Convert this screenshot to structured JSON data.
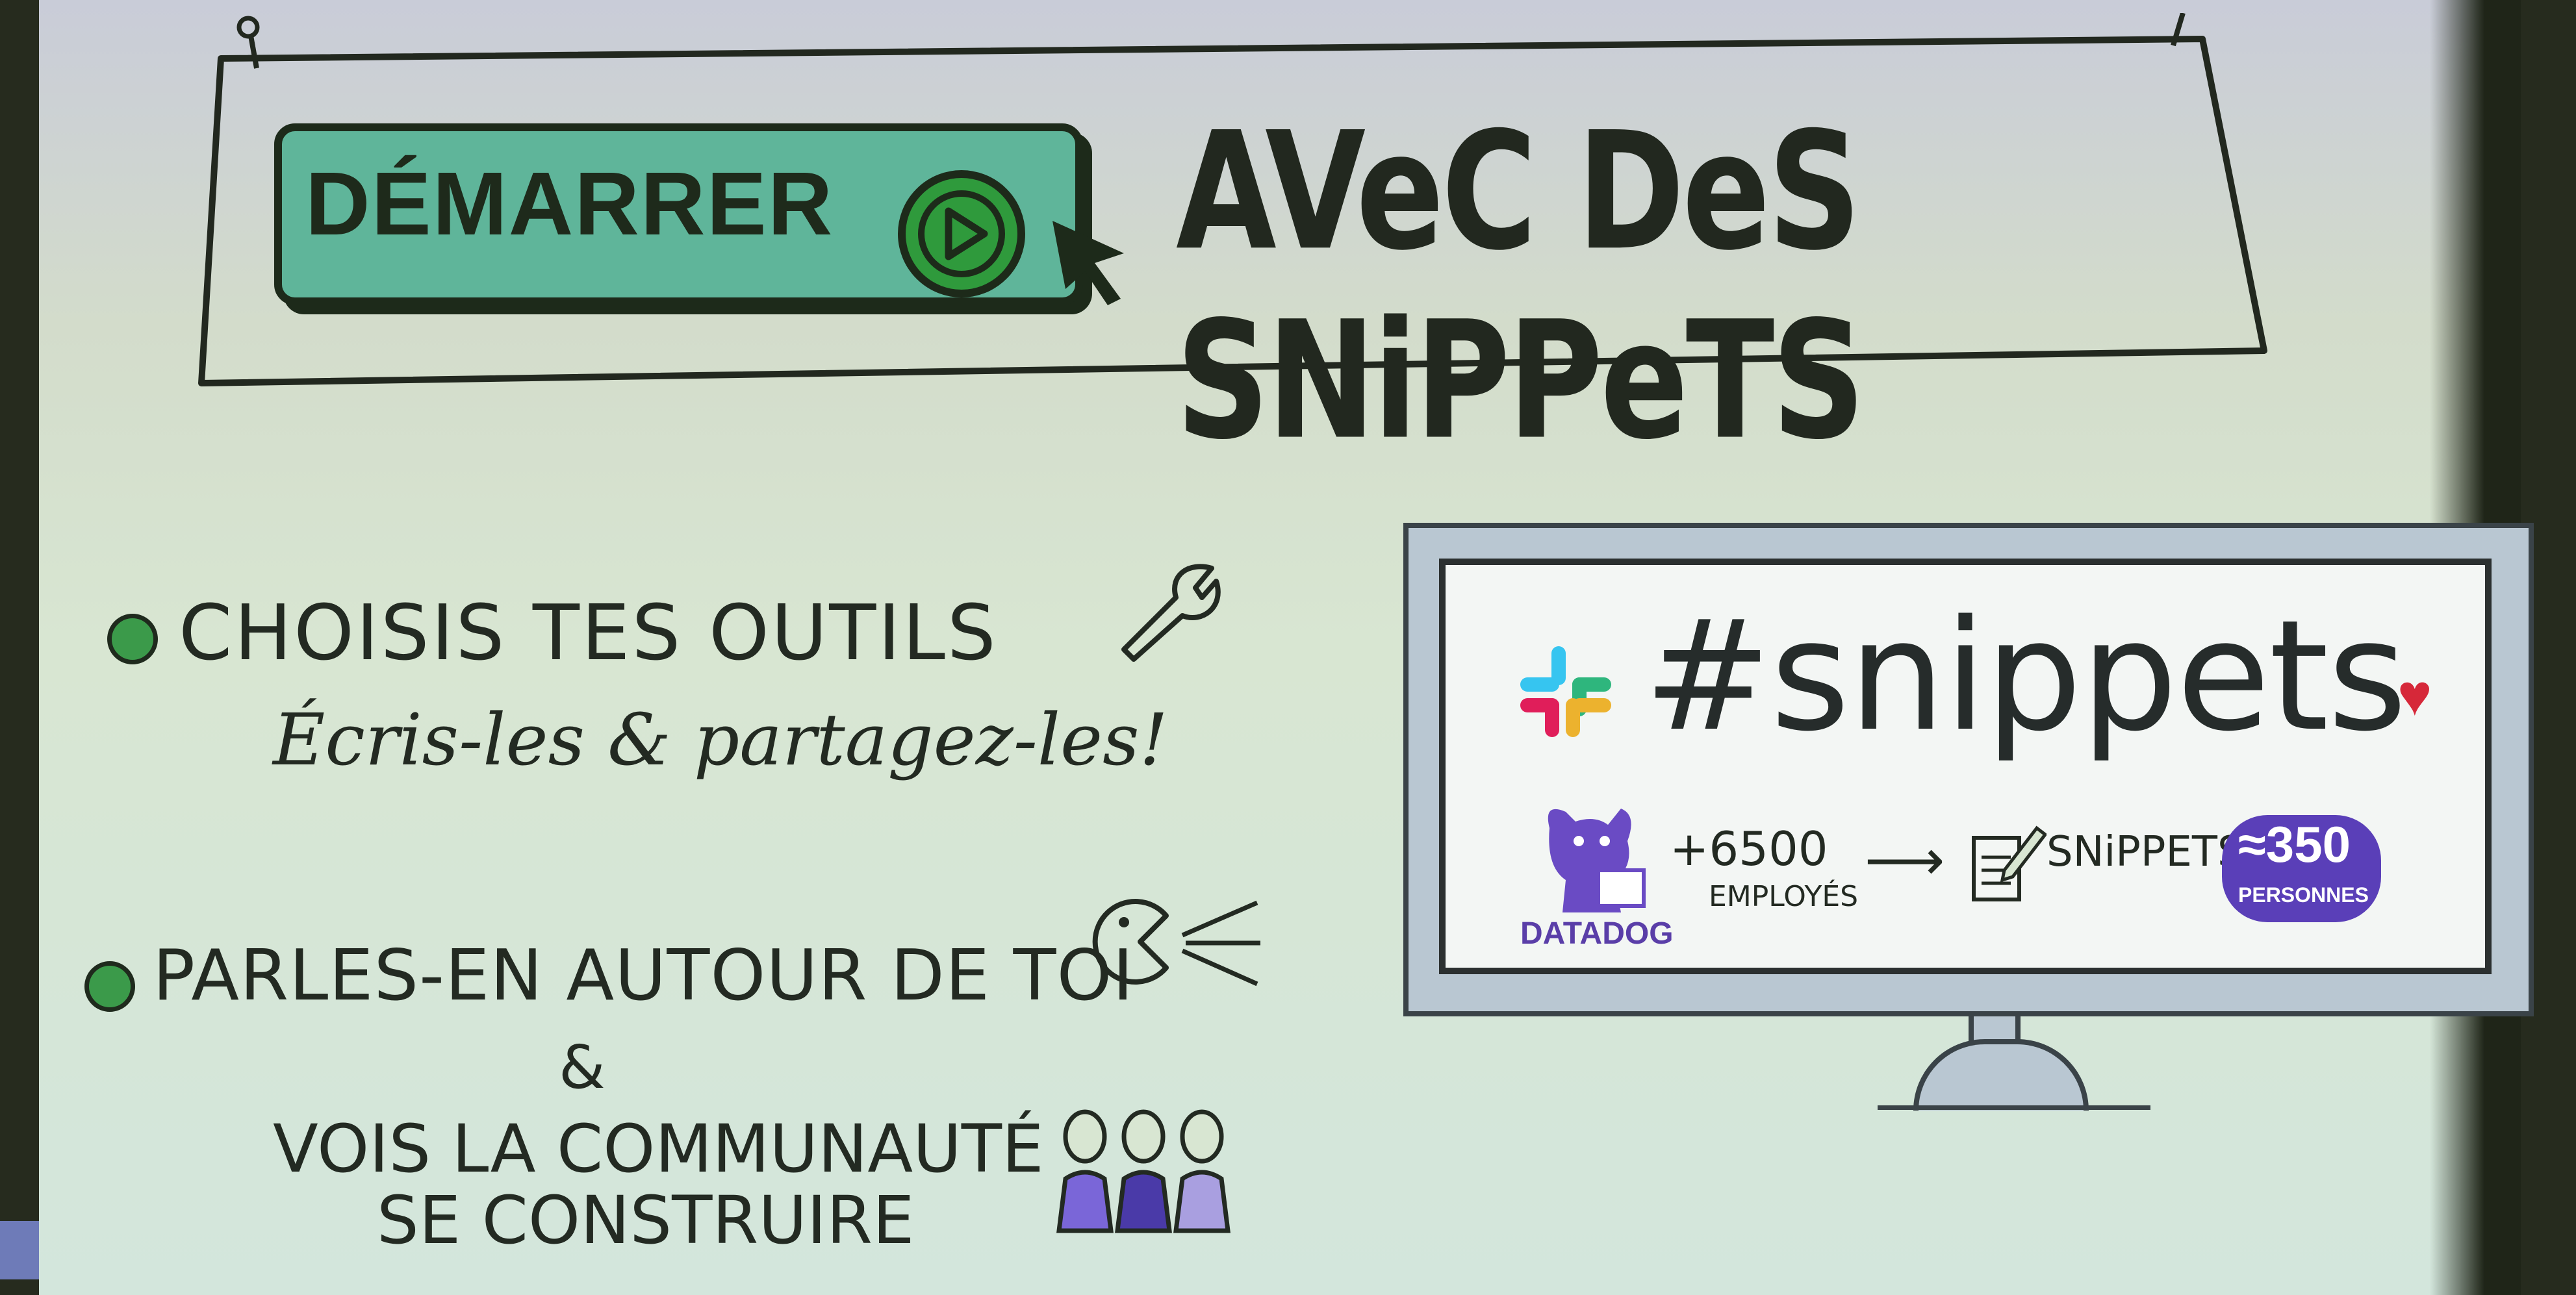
{
  "banner": {
    "button_label": "DÉMARRER",
    "title_rest": "AVeC DeS SNiPPeTS"
  },
  "points": [
    {
      "text": "CHOISIS TES OUTILS",
      "script": "Écris-les & partagez-les!"
    },
    {
      "text": "PARLES-EN AUTOUR DE TOI",
      "amp": "&",
      "line2": "VOIS LA COMMUNAUTÉ",
      "line3": "SE CONSTRUIRE"
    }
  ],
  "monitor": {
    "channel": "#snippets",
    "company": "DATADOG",
    "employees_count": "+6500",
    "employees_label": "EMPLOYÉS",
    "arrow": "⟶",
    "snippets_label": "SNiPPETS",
    "people_count": "≈350",
    "people_label": "PERSONNES"
  },
  "colors": {
    "accent_green": "#3b9a4a",
    "button_teal": "#5fb59a",
    "datadog_purple": "#5a3fb8",
    "heart_red": "#d62839"
  },
  "icons": [
    "play-icon",
    "cursor-icon",
    "wrench-icon",
    "pacman-icon",
    "people-icon",
    "slack-icon",
    "datadog-dog-icon",
    "heart-icon",
    "notepad-pencil-icon"
  ]
}
